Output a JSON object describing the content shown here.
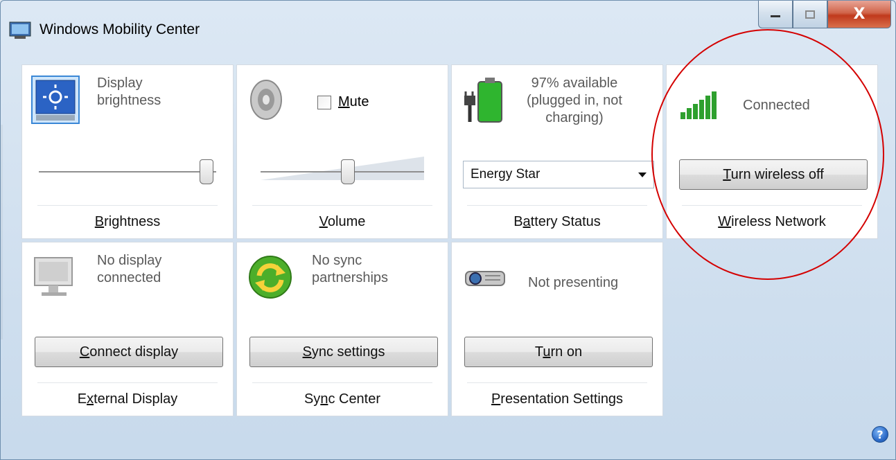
{
  "window": {
    "title": "Windows Mobility Center",
    "close_label": "X"
  },
  "tiles": {
    "brightness": {
      "desc": [
        "Display",
        "brightness"
      ],
      "name_ul": "B",
      "name_rest": "rightness",
      "level": 1.0
    },
    "volume": {
      "mute_ul": "M",
      "mute_rest": "ute",
      "name_ul": "V",
      "name_rest": "olume",
      "level": 0.5
    },
    "battery": {
      "desc": [
        "97% available",
        "(plugged in, not",
        "charging)"
      ],
      "plan": "Energy Star",
      "name_pre": "B",
      "name_ul": "a",
      "name_rest": "ttery Status",
      "charge": 0.97
    },
    "wireless": {
      "desc": "Connected",
      "button_ul": "T",
      "button_rest": "urn wireless off",
      "name_ul": "W",
      "name_rest": "ireless Network"
    },
    "external": {
      "desc": [
        "No display",
        "connected"
      ],
      "button_ul": "C",
      "button_rest": "onnect display",
      "name_pre": "E",
      "name_ul": "x",
      "name_rest": "ternal Display"
    },
    "sync": {
      "desc": [
        "No sync",
        "partnerships"
      ],
      "button_ul": "S",
      "button_rest": "ync settings",
      "name_pre": "Sy",
      "name_ul": "n",
      "name_rest": "c Center"
    },
    "presentation": {
      "desc": "Not presenting",
      "button_pre": "T",
      "button_ul": "u",
      "button_rest": "rn on",
      "name_ul": "P",
      "name_rest": "resentation Settings"
    }
  },
  "help": {
    "label": "?"
  },
  "colors": {
    "annotation": "#d40000",
    "wifi_green": "#2ea02e"
  }
}
